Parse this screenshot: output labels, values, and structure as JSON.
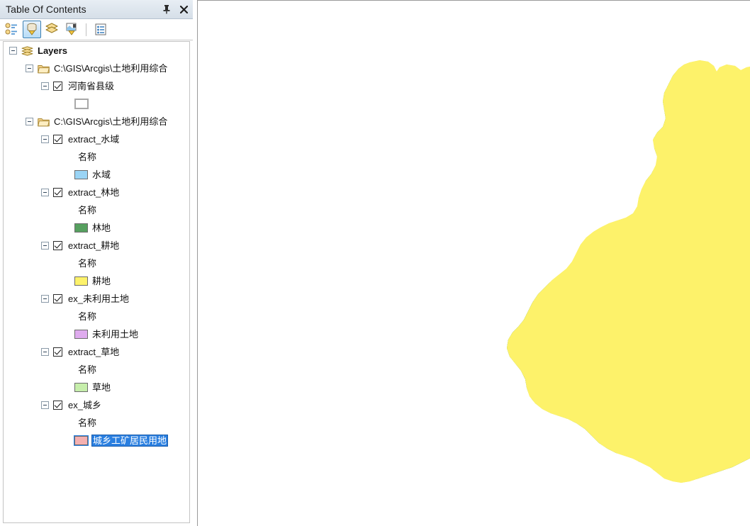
{
  "panel": {
    "title": "Table Of Contents",
    "buttons": [
      {
        "name": "auto-hide-pin",
        "glyph": "pin"
      },
      {
        "name": "close",
        "glyph": "x"
      }
    ],
    "toolbar": [
      {
        "name": "list-by-drawing-order",
        "tooltip": "List By Drawing Order",
        "active": false
      },
      {
        "name": "list-by-source",
        "tooltip": "List By Source",
        "active": true
      },
      {
        "name": "list-by-visibility",
        "tooltip": "List By Visibility",
        "active": false
      },
      {
        "name": "list-by-selection",
        "tooltip": "List By Selection",
        "active": false
      },
      {
        "name": "options",
        "tooltip": "Options",
        "active": false
      }
    ]
  },
  "tree": {
    "root_label": "Layers",
    "groups": [
      {
        "path_label": "C:\\GIS\\Arcgis\\土地利用综合",
        "layers": [
          {
            "name": "河南省县级",
            "checked": true,
            "field_label": null,
            "symbols": [
              {
                "label": "",
                "color": "#ffffff",
                "hollow": true,
                "selected": false
              }
            ]
          }
        ]
      },
      {
        "path_label": "C:\\GIS\\Arcgis\\土地利用综合",
        "layers": [
          {
            "name": "extract_水域",
            "checked": true,
            "field_label": "名称",
            "symbols": [
              {
                "label": "水域",
                "color": "#9ad4f5",
                "hollow": false,
                "selected": false
              }
            ]
          },
          {
            "name": "extract_林地",
            "checked": true,
            "field_label": "名称",
            "symbols": [
              {
                "label": "林地",
                "color": "#56a05f",
                "hollow": false,
                "selected": false
              }
            ]
          },
          {
            "name": "extract_耕地",
            "checked": true,
            "field_label": "名称",
            "symbols": [
              {
                "label": "耕地",
                "color": "#fdf26a",
                "hollow": false,
                "selected": false
              }
            ]
          },
          {
            "name": "ex_未利用土地",
            "checked": true,
            "field_label": "名称",
            "symbols": [
              {
                "label": "未利用土地",
                "color": "#dfabee",
                "hollow": false,
                "selected": false
              }
            ]
          },
          {
            "name": "extract_草地",
            "checked": true,
            "field_label": "名称",
            "symbols": [
              {
                "label": "草地",
                "color": "#c6eeab",
                "hollow": false,
                "selected": false
              }
            ]
          },
          {
            "name": "ex_城乡",
            "checked": true,
            "field_label": "名称",
            "symbols": [
              {
                "label": "城乡工矿居民用地",
                "color": "#f4b0b0",
                "hollow": false,
                "selected": true
              }
            ]
          }
        ]
      }
    ]
  },
  "map": {
    "description": "Land use classification map of Henan Province with county boundaries",
    "background": "#ffffff",
    "boundary_color": "#6b6b6b",
    "classes": [
      {
        "label": "耕地",
        "color": "#fdf26a"
      },
      {
        "label": "林地",
        "color": "#56a05f"
      },
      {
        "label": "草地",
        "color": "#c6eeab"
      },
      {
        "label": "水域",
        "color": "#9ad4f5"
      },
      {
        "label": "城乡工矿居民用地",
        "color": "#f4b0b0"
      },
      {
        "label": "未利用土地",
        "color": "#dfabee"
      }
    ]
  }
}
